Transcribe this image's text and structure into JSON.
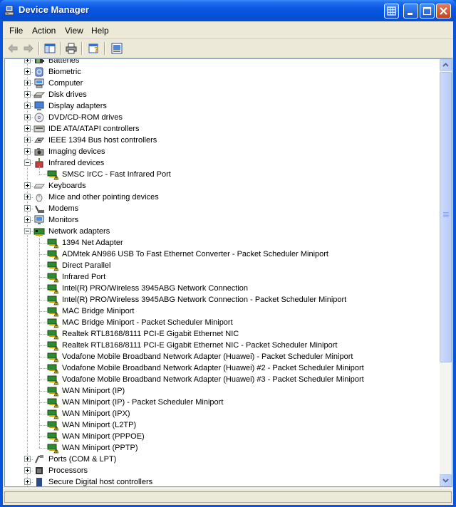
{
  "window": {
    "title": "Device Manager"
  },
  "title_buttons": [
    {
      "name": "tile-windows-button",
      "icon": "grid-icon"
    },
    {
      "name": "minimize-button",
      "icon": "minimize-icon"
    },
    {
      "name": "maximize-button",
      "icon": "maximize-icon"
    },
    {
      "name": "close-button",
      "icon": "close-icon"
    }
  ],
  "menubar": {
    "file": "File",
    "action": "Action",
    "view": "View",
    "help": "Help"
  },
  "toolbar": [
    {
      "name": "back-button",
      "icon": "back-arrow-icon",
      "enabled": false
    },
    {
      "name": "forward-button",
      "icon": "forward-arrow-icon",
      "enabled": false
    },
    {
      "name": "show-hide-console-tree-button",
      "icon": "console-tree-icon",
      "enabled": true
    },
    {
      "name": "print-button",
      "icon": "printer-icon",
      "enabled": true
    },
    {
      "name": "help-button",
      "icon": "help-icon",
      "enabled": true
    },
    {
      "name": "properties-button",
      "icon": "properties-icon",
      "enabled": true
    }
  ],
  "tree": {
    "categories": [
      {
        "label": "Batteries",
        "icon": "battery-icon",
        "expanded": false
      },
      {
        "label": "Biometric",
        "icon": "biometric-icon",
        "expanded": false
      },
      {
        "label": "Computer",
        "icon": "computer-icon",
        "expanded": false
      },
      {
        "label": "Disk drives",
        "icon": "disk-drive-icon",
        "expanded": false
      },
      {
        "label": "Display adapters",
        "icon": "display-adapter-icon",
        "expanded": false
      },
      {
        "label": "DVD/CD-ROM drives",
        "icon": "cdrom-icon",
        "expanded": false
      },
      {
        "label": "IDE ATA/ATAPI controllers",
        "icon": "ide-controller-icon",
        "expanded": false
      },
      {
        "label": "IEEE 1394 Bus host controllers",
        "icon": "firewire-icon",
        "expanded": false
      },
      {
        "label": "Imaging devices",
        "icon": "camera-icon",
        "expanded": false
      },
      {
        "label": "Infrared devices",
        "icon": "infrared-icon",
        "expanded": true,
        "children": [
          {
            "label": "SMSC IrCC - Fast Infrared Port",
            "icon": "warning-device-icon"
          }
        ]
      },
      {
        "label": "Keyboards",
        "icon": "keyboard-icon",
        "expanded": false
      },
      {
        "label": "Mice and other pointing devices",
        "icon": "mouse-icon",
        "expanded": false
      },
      {
        "label": "Modems",
        "icon": "modem-icon",
        "expanded": false
      },
      {
        "label": "Monitors",
        "icon": "monitor-icon",
        "expanded": false
      },
      {
        "label": "Network adapters",
        "icon": "network-adapter-icon",
        "expanded": true,
        "children": [
          {
            "label": "1394 Net Adapter",
            "icon": "warning-device-icon"
          },
          {
            "label": "ADMtek AN986 USB To Fast Ethernet Converter - Packet Scheduler Miniport",
            "icon": "warning-device-icon"
          },
          {
            "label": "Direct Parallel",
            "icon": "warning-device-icon"
          },
          {
            "label": "Infrared Port",
            "icon": "warning-device-icon"
          },
          {
            "label": "Intel(R) PRO/Wireless 3945ABG Network Connection",
            "icon": "warning-device-icon"
          },
          {
            "label": "Intel(R) PRO/Wireless 3945ABG Network Connection - Packet Scheduler Miniport",
            "icon": "warning-device-icon"
          },
          {
            "label": "MAC Bridge Miniport",
            "icon": "warning-device-icon"
          },
          {
            "label": "MAC Bridge Miniport - Packet Scheduler Miniport",
            "icon": "warning-device-icon"
          },
          {
            "label": "Realtek RTL8168/8111 PCI-E Gigabit Ethernet NIC",
            "icon": "warning-device-icon"
          },
          {
            "label": "Realtek RTL8168/8111 PCI-E Gigabit Ethernet NIC - Packet Scheduler Miniport",
            "icon": "warning-device-icon"
          },
          {
            "label": "Vodafone Mobile Broadband Network Adapter (Huawei) - Packet Scheduler Miniport",
            "icon": "warning-device-icon"
          },
          {
            "label": "Vodafone Mobile Broadband Network Adapter (Huawei) #2 - Packet Scheduler Miniport",
            "icon": "warning-device-icon"
          },
          {
            "label": "Vodafone Mobile Broadband Network Adapter (Huawei) #3 - Packet Scheduler Miniport",
            "icon": "warning-device-icon"
          },
          {
            "label": "WAN Miniport (IP)",
            "icon": "warning-device-icon"
          },
          {
            "label": "WAN Miniport (IP) - Packet Scheduler Miniport",
            "icon": "warning-device-icon"
          },
          {
            "label": "WAN Miniport (IPX)",
            "icon": "warning-device-icon"
          },
          {
            "label": "WAN Miniport (L2TP)",
            "icon": "warning-device-icon"
          },
          {
            "label": "WAN Miniport (PPPOE)",
            "icon": "warning-device-icon"
          },
          {
            "label": "WAN Miniport (PPTP)",
            "icon": "warning-device-icon"
          }
        ]
      },
      {
        "label": "Ports (COM & LPT)",
        "icon": "port-icon",
        "expanded": false
      },
      {
        "label": "Processors",
        "icon": "processor-icon",
        "expanded": false
      },
      {
        "label": "Secure Digital host controllers",
        "icon": "sd-controller-icon",
        "expanded": false
      }
    ]
  },
  "status": {
    "text": ""
  }
}
